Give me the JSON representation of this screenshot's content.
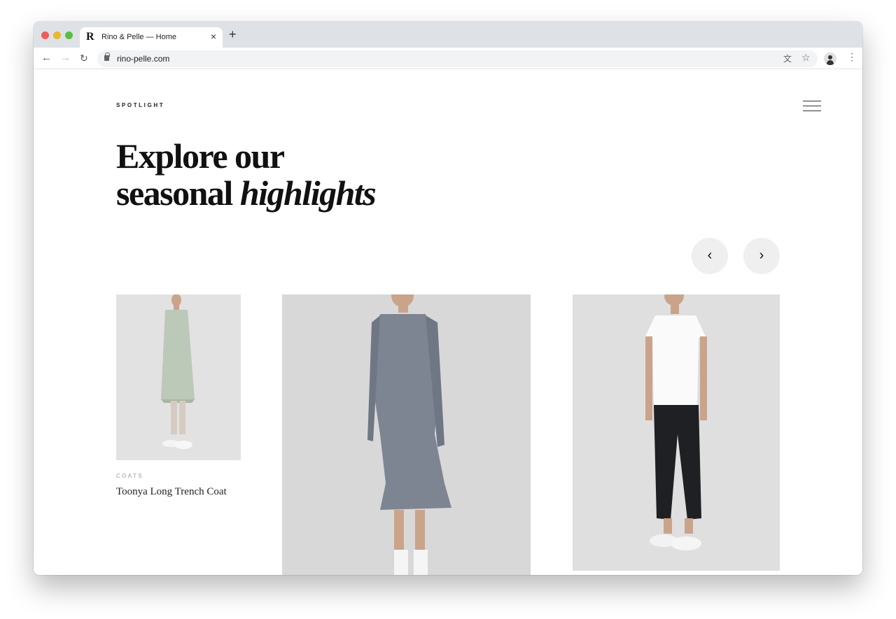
{
  "browser": {
    "tab_title": "Rino & Pelle — Home",
    "favicon_letter": "R",
    "close_glyph": "×",
    "newtab_glyph": "+",
    "url": "rino-pelle.com",
    "icons": {
      "back": "arrow-left-icon",
      "forward": "arrow-right-icon",
      "reload": "reload-icon",
      "lock": "lock-icon",
      "translate": "translate-icon",
      "bookmark": "star-icon",
      "profile": "avatar-icon",
      "menu": "kebab-menu-icon"
    }
  },
  "page": {
    "eyebrow": "SPOTLIGHT",
    "headline_line1": "Explore our",
    "headline_line2_plain": "seasonal",
    "headline_line2_italic": "highlights",
    "menu_icon": "hamburger-icon",
    "carousel_prev_icon": "chevron-left-icon",
    "carousel_next_icon": "chevron-right-icon",
    "products": [
      {
        "category": "COATS",
        "name": "Toonya Long Trench Coat",
        "image": "model wearing mint trench coat"
      },
      {
        "category": "",
        "name": "",
        "image": "model wearing printed long-sleeve dress"
      },
      {
        "category": "",
        "name": "",
        "image": "model wearing white t-shirt and black leather trousers"
      }
    ]
  },
  "colors": {
    "accent": "#111111",
    "card_bg": "#e2e2e2",
    "muted_text": "#9a9a9a"
  }
}
